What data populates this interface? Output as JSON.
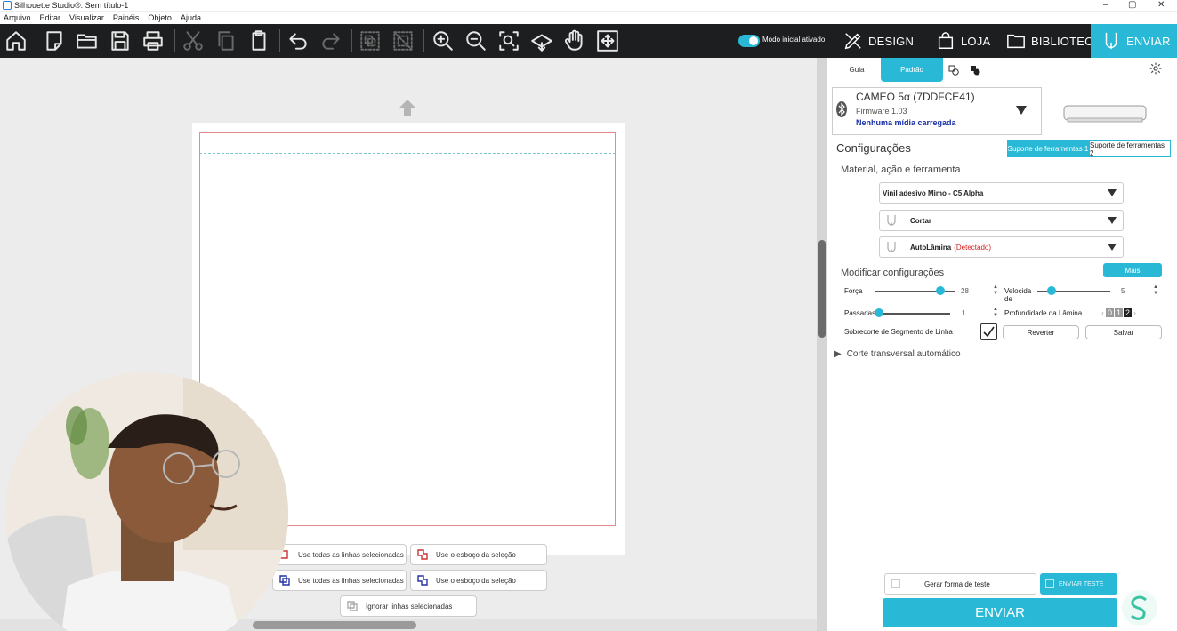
{
  "window": {
    "title": "Silhouette Studio®: Sem título-1",
    "minimize": "–",
    "maximize": "▢",
    "close": "✕"
  },
  "menu": [
    "Arquivo",
    "Editar",
    "Visualizar",
    "Painéis",
    "Objeto",
    "Ajuda"
  ],
  "toolbar": {
    "icons": [
      "home-icon",
      "new-document-icon",
      "open-folder-icon",
      "save-icon",
      "print-icon",
      "cut-icon",
      "copy-icon",
      "paste-icon",
      "undo-icon",
      "redo-icon",
      "group-icon",
      "ungroup-icon",
      "zoom-in-icon",
      "zoom-out-icon",
      "zoom-fit-icon",
      "pan-down-icon",
      "hand-icon",
      "move-icon"
    ],
    "mode_toggle_label": "Modo inicial ativado",
    "nav": {
      "design": "DESIGN",
      "loja": "LOJA",
      "biblioteca": "BIBLIOTECA",
      "enviar": "ENVIAR"
    }
  },
  "canvas": {
    "selection_buttons": [
      "Use todas as linhas selecionadas",
      "Use o esboço da seleção",
      "Use todas as linhas selecionadas",
      "Use o esboço da seleção",
      "Ignorar linhas selecionadas"
    ]
  },
  "panel": {
    "tabs": [
      "Guia",
      "Padrão"
    ],
    "device": {
      "name": "CAMEO 5α (7DDFCE41)",
      "firmware": "Firmware 1.03",
      "media_status": "Nenhuma mídia carregada"
    },
    "configuracoes": "Configurações",
    "tool_tabs": [
      "Suporte de ferramentas 1",
      "Suporte de ferramentas 2"
    ],
    "material_heading": "Material, ação e ferramenta",
    "material": "Vinil adesivo Mimo - C5 Alpha",
    "action": "Cortar",
    "tool": "AutoLâmina",
    "tool_detected": "(Detectado)",
    "modify_heading": "Modificar configurações",
    "mais": "Mais",
    "forca_label": "Força",
    "forca_value": "28",
    "forca_fraction": 0.82,
    "velocidade_label_1": "Velocida",
    "velocidade_label_2": "de",
    "velocidade_value": "5",
    "velocidade_fraction": 0.2,
    "passadas_label": "Passadas",
    "passadas_value": "1",
    "passadas_fraction": 0.0,
    "profundidade_label": "Profundidade da Lâmina",
    "profundidade_digits": [
      "0",
      "1",
      "2"
    ],
    "sobrecorte_label": "Sobrecorte de Segmento de Linha",
    "sobrecorte_checked": true,
    "reverter": "Reverter",
    "salvar": "Salvar",
    "corte_transversal": "Corte transversal automático",
    "gerar_teste": "Gerar forma de teste",
    "enviar_teste": "ENVIAR TESTE",
    "enviar": "ENVIAR"
  },
  "colors": {
    "accent": "#29b8d6",
    "toolbar_bg": "#1d1e1f",
    "cut_line": "#e48c8c",
    "media_status": "#1a2fa8",
    "detected": "#d22222"
  }
}
